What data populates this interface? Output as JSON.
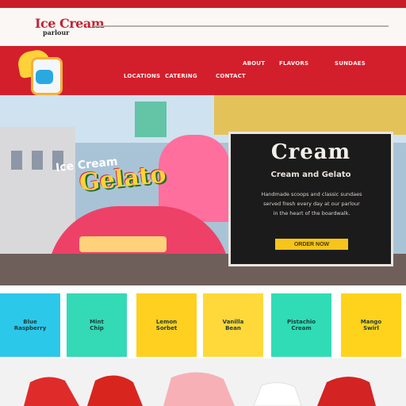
{
  "header": {
    "logo_text": "Ice Cream",
    "logo_sub": "parlour",
    "search_placeholder": ""
  },
  "nav": {
    "items": [
      {
        "label": "ABOUT"
      },
      {
        "label": "FLAVORS"
      },
      {
        "label": "SUNDAES"
      },
      {
        "label": "LOCATIONS"
      },
      {
        "label": "CATERING"
      },
      {
        "label": "CONTACT"
      }
    ]
  },
  "hero": {
    "sign_text": "Gelato",
    "sign_small": "Ice Cream"
  },
  "card": {
    "title": "Cream",
    "subtitle": "Cream and Gelato",
    "lines": [
      "Handmade scoops and classic sundaes",
      "served fresh every day at our parlour",
      "in the heart of the boardwalk."
    ],
    "button_label": "ORDER NOW"
  },
  "tiles": [
    {
      "name": "Blue\nRaspberry",
      "color": "#2cc8ea"
    },
    {
      "name": "Mint\nChip",
      "color": "#34d9b6"
    },
    {
      "name": "Lemon\nSorbet",
      "color": "#ffd01f"
    },
    {
      "name": "Vanilla\nBean",
      "color": "#ffd83a"
    },
    {
      "name": "Pistachio\nCream",
      "color": "#30dcb5"
    },
    {
      "name": "Mango\nSwirl",
      "color": "#ffd31c"
    }
  ],
  "colors": {
    "brand_red": "#d31f2b",
    "card_bg": "#1c1b1b",
    "button": "#f7c51a"
  }
}
